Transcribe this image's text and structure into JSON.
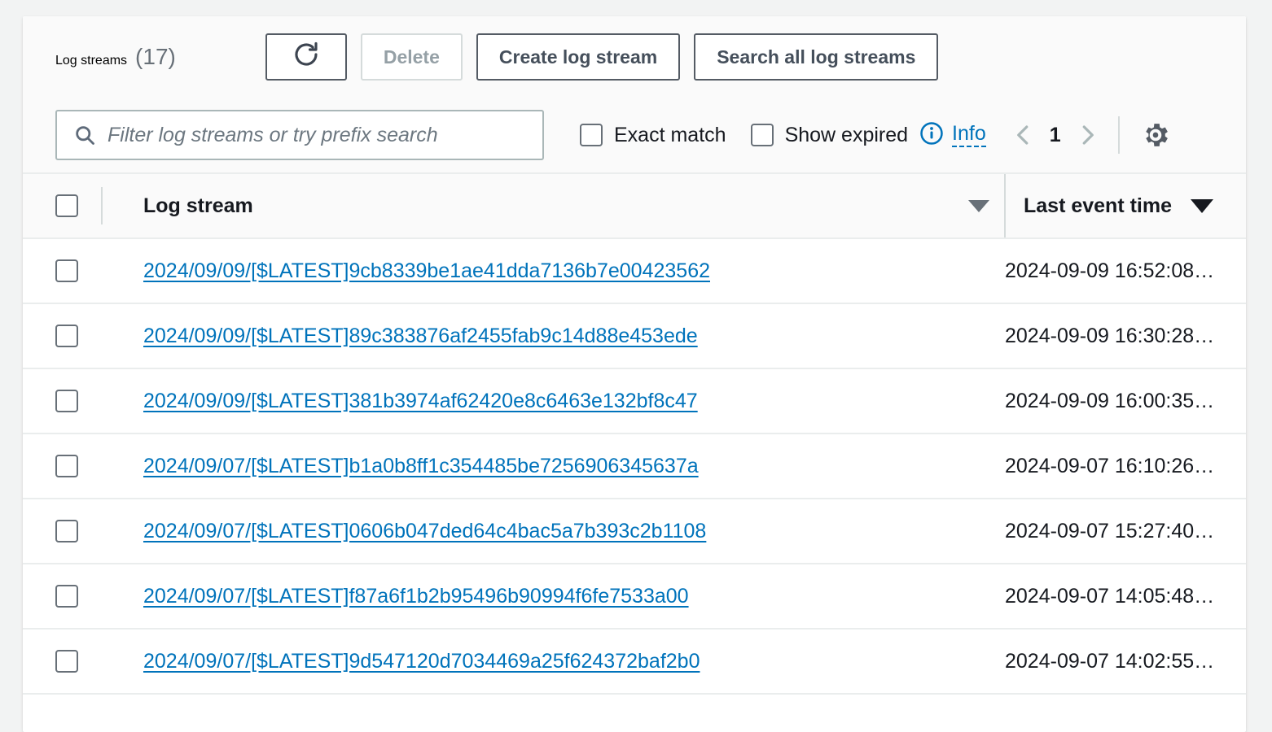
{
  "header": {
    "title": "Log streams",
    "count": "(17)",
    "refresh_icon": "refresh-icon",
    "buttons": [
      {
        "label": "Delete",
        "disabled": true
      },
      {
        "label": "Create log stream",
        "disabled": false
      },
      {
        "label": "Search all log streams",
        "disabled": false
      }
    ]
  },
  "filter": {
    "search_icon": "search-icon",
    "placeholder": "Filter log streams or try prefix search",
    "value": "",
    "exact_match_label": "Exact match",
    "exact_match_checked": false,
    "show_expired_label": "Show expired",
    "show_expired_checked": false,
    "info_label": "Info",
    "info_icon": "info-circle-icon"
  },
  "pagination": {
    "prev_icon": "chevron-left-icon",
    "next_icon": "chevron-right-icon",
    "current_page": "1",
    "settings_icon": "gear-icon"
  },
  "table": {
    "columns": [
      {
        "label": "Log stream",
        "sort_icon": "caret-down-icon",
        "sort_active": false
      },
      {
        "label": "Last event time",
        "sort_icon": "caret-down-icon",
        "sort_active": true
      }
    ],
    "rows": [
      {
        "stream": "2024/09/09/[$LATEST]9cb8339be1ae41dda7136b7e00423562",
        "time": "2024-09-09 16:52:08…"
      },
      {
        "stream": "2024/09/09/[$LATEST]89c383876af2455fab9c14d88e453ede",
        "time": "2024-09-09 16:30:28…"
      },
      {
        "stream": "2024/09/09/[$LATEST]381b3974af62420e8c6463e132bf8c47",
        "time": "2024-09-09 16:00:35…"
      },
      {
        "stream": "2024/09/07/[$LATEST]b1a0b8ff1c354485be7256906345637a",
        "time": "2024-09-07 16:10:26…"
      },
      {
        "stream": "2024/09/07/[$LATEST]0606b047ded64c4bac5a7b393c2b1108",
        "time": "2024-09-07 15:27:40…"
      },
      {
        "stream": "2024/09/07/[$LATEST]f87a6f1b2b95496b90994f6fe7533a00",
        "time": "2024-09-07 14:05:48…"
      },
      {
        "stream": "2024/09/07/[$LATEST]9d547120d7034469a25f624372baf2b0",
        "time": "2024-09-07 14:02:55…"
      }
    ]
  },
  "colors": {
    "link": "#0073bb",
    "text": "#16191f",
    "muted": "#687078",
    "border": "#eaeded",
    "button_border": "#545b64",
    "header_bg": "#fafafa"
  }
}
